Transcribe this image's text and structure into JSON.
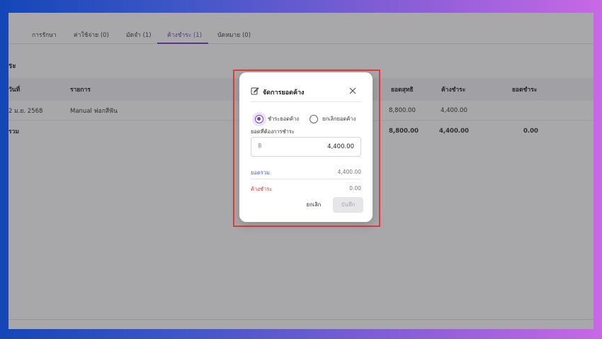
{
  "tabs": [
    {
      "label": "ี้"
    },
    {
      "label": "การรักษา"
    },
    {
      "label": "ค่าใช้จ่าย (0)"
    },
    {
      "label": "มัดจำ (1)"
    },
    {
      "label": "ค้างชำระ (1)"
    },
    {
      "label": "นัดหมาย (0)"
    }
  ],
  "section_title": "ระ",
  "table": {
    "headers": {
      "date": "วันที่",
      "item": "รายการ",
      "net": "ยอดสุทธิ",
      "outstanding": "ค้างชำระ",
      "paid": "ยอดชำระ"
    },
    "rows": [
      {
        "date": "2 ม.ย. 2568",
        "item": "Manual ฟอกสีฟัน",
        "net": "8,800.00",
        "outstanding": "4,400.00",
        "paid": ""
      }
    ],
    "total": {
      "label": "รวม",
      "net": "8,800.00",
      "outstanding": "4,400.00",
      "paid": "0.00"
    }
  },
  "modal": {
    "title": "จัดการยอดค้าง",
    "options": {
      "pay": "ชำระยอดค้าง",
      "cancel": "ยกเลิกยอดค้าง"
    },
    "selected_option": "pay",
    "amount_label": "ยอดที่ต้องการชำระ",
    "currency_symbol": "฿",
    "amount_value": "4,400.00",
    "summary": {
      "total_label": "ยอดรวม",
      "total_value": "4,400.00",
      "remaining_label": "ค้างชำระ",
      "remaining_value": "0.00"
    },
    "cancel_button": "ยกเลิก",
    "save_button": "บันทึก"
  },
  "colors": {
    "accent": "#7b3fc4",
    "total_label": "#3b5bdb",
    "remaining_label": "#e03131",
    "highlight_border": "#e23b3b"
  }
}
